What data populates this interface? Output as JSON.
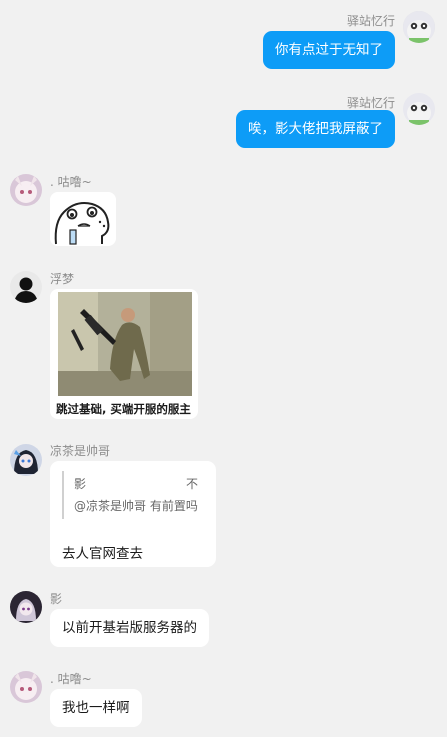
{
  "messages": [
    {
      "sender": "驿站忆行",
      "text": "你有点过于无知了"
    },
    {
      "sender": "驿站忆行",
      "text": "唉，影大佬把我屏蔽了"
    },
    {
      "sender": ". 咕噜~",
      "sticker": "doodle-face-sticker"
    },
    {
      "sender": "浮梦",
      "image_caption": "跳过基础, 买端开服的服主"
    },
    {
      "sender": "凉茶是帅哥",
      "reply": {
        "quoted_sender": "影",
        "quoted_tail": "不",
        "quoted_text": "@凉茶是帅哥 有前置吗"
      },
      "text": "去人官网查去"
    },
    {
      "sender": "影",
      "text": "以前开基岩版服务器的"
    },
    {
      "sender": ". 咕噜~",
      "text": "我也一样啊"
    }
  ],
  "colors": {
    "background": "#f1f1f1",
    "self_bubble": "#0d9cf7",
    "other_bubble": "#ffffff",
    "nickname": "#8c8c8c"
  }
}
